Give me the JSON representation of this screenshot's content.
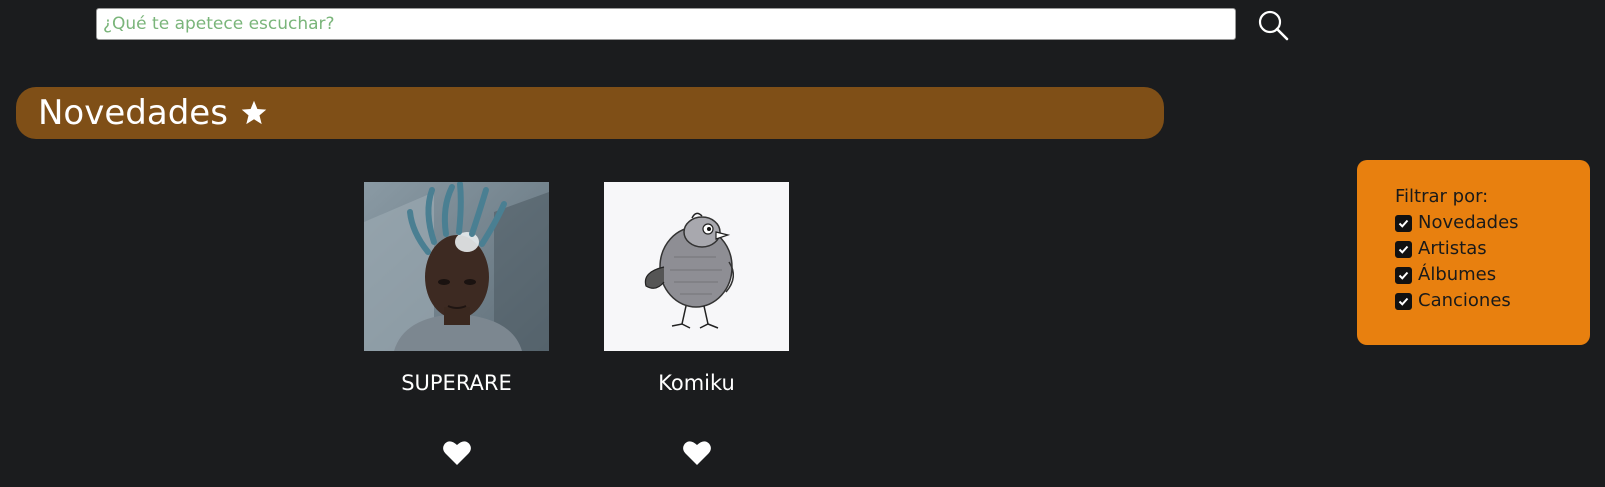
{
  "search": {
    "placeholder": "¿Qué te apetece escuchar?",
    "value": "",
    "button_icon": "search-icon"
  },
  "section": {
    "title": "Novedades",
    "icon": "star-icon",
    "color": "#7f4f17"
  },
  "cards": [
    {
      "name": "SUPERARE",
      "image": "artist-photo-superare",
      "favorite_icon": "heart-icon"
    },
    {
      "name": "Komiku",
      "image": "artist-drawing-komiku",
      "favorite_icon": "heart-icon"
    }
  ],
  "filter": {
    "label": "Filtrar por:",
    "color": "#e8800f",
    "options": [
      {
        "label": "Novedades",
        "checked": true
      },
      {
        "label": "Artistas",
        "checked": true
      },
      {
        "label": "Álbumes",
        "checked": true
      },
      {
        "label": "Canciones",
        "checked": true
      }
    ]
  },
  "colors": {
    "background": "#1b1c1e",
    "text": "#ffffff"
  }
}
